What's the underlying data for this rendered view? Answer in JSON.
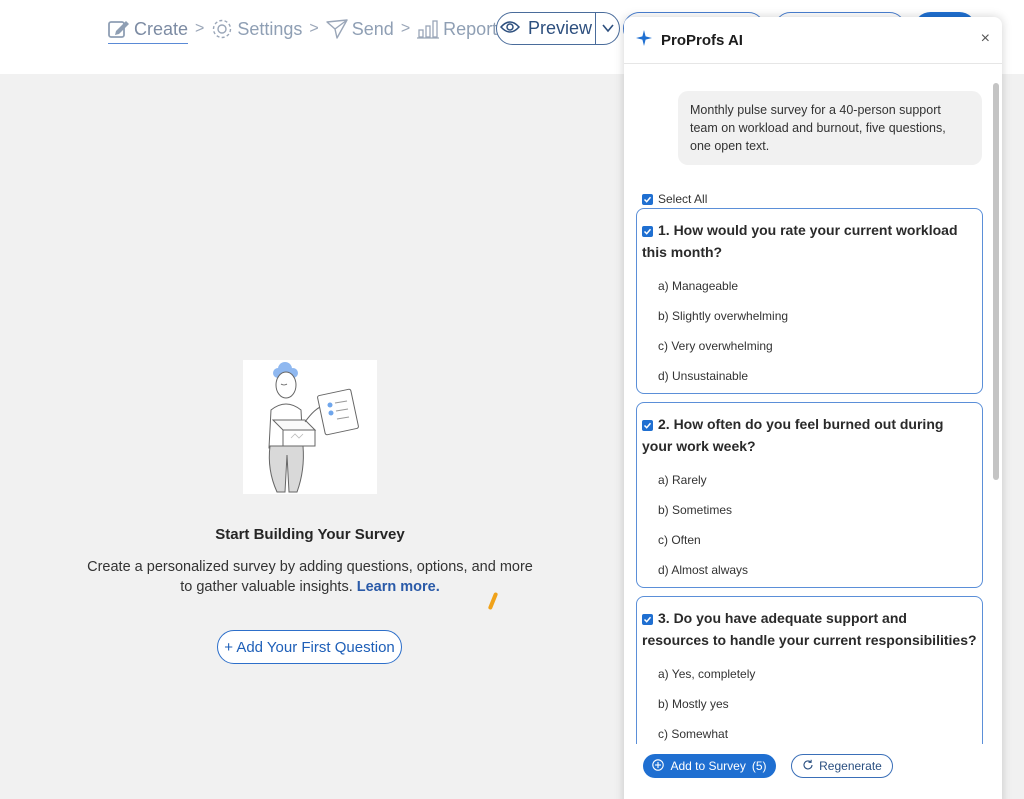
{
  "nav": {
    "steps": [
      {
        "label": "Create",
        "icon": "edit-icon",
        "active": true
      },
      {
        "label": "Settings",
        "icon": "gear-icon",
        "active": false
      },
      {
        "label": "Send",
        "icon": "send-icon",
        "active": false
      },
      {
        "label": "Reports",
        "icon": "bar-chart-icon",
        "active": false
      }
    ],
    "separator": ">",
    "preview_label": "Preview"
  },
  "empty_state": {
    "title": "Start Building Your Survey",
    "description": "Create a personalized survey by adding questions, options, and more to gather valuable insights.",
    "learn_more": "Learn more.",
    "add_first_question": "+ Add Your First Question"
  },
  "ai_panel": {
    "title": "ProProfs AI",
    "close_glyph": "×",
    "prompt": "Monthly pulse survey for a 40-person support team on workload and burnout, five questions, one open text.",
    "select_all_label": "Select All",
    "questions": [
      {
        "text": "1. How would you rate your current workload this month?",
        "checked": true,
        "options": [
          "a) Manageable",
          "b) Slightly overwhelming",
          "c) Very overwhelming",
          "d) Unsustainable"
        ]
      },
      {
        "text": "2. How often do you feel burned out during your work week?",
        "checked": true,
        "options": [
          "a) Rarely",
          "b) Sometimes",
          "c) Often",
          "d) Almost always"
        ]
      },
      {
        "text": "3. Do you have adequate support and resources to handle your current responsibilities?",
        "checked": true,
        "options": [
          "a) Yes, completely",
          "b) Mostly yes",
          "c) Somewhat"
        ]
      }
    ],
    "add_button_label": "Add to Survey",
    "add_button_count": "(5)",
    "regenerate_label": "Regenerate"
  },
  "colors": {
    "accent": "#1f6fd1",
    "border_blue": "#5b8fd8",
    "background": "#f1f1f1",
    "nav_inactive": "#8f9fb4",
    "cursor_mark": "#f0a21a"
  }
}
